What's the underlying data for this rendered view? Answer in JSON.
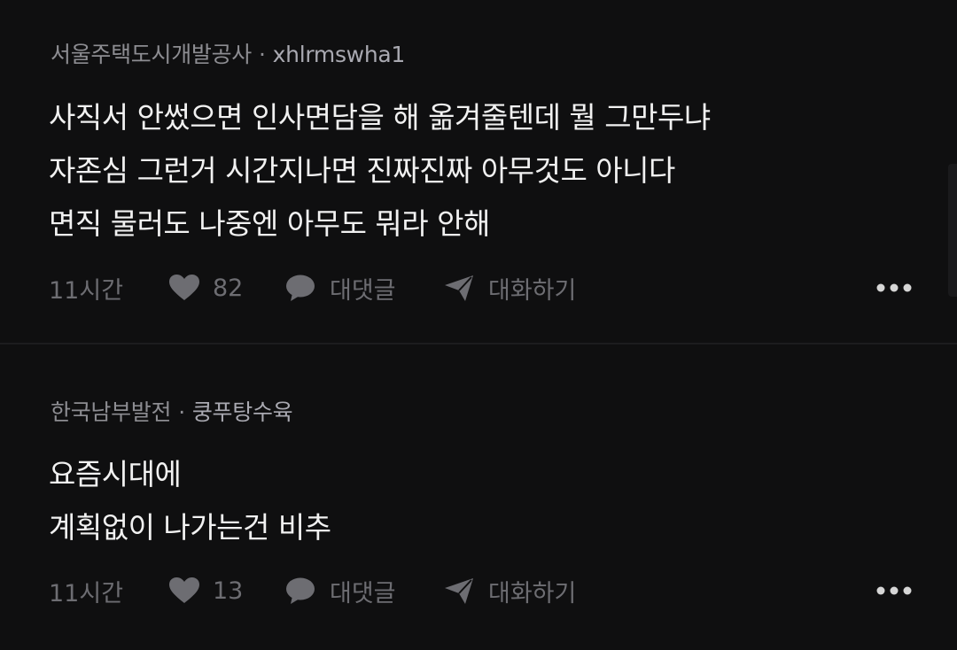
{
  "comments": [
    {
      "company": "서울주택도시개발공사",
      "separator": "·",
      "nickname": "xhlrmswha1",
      "lines": [
        "사직서 안썼으면 인사면담을 해 옮겨줄텐데 뭘 그만두냐",
        "자존심 그런거 시간지나면 진짜진짜 아무것도 아니다",
        "면직 물러도 나중엔 아무도 뭐라 안해"
      ],
      "time": "11시간",
      "likes": "82",
      "reply_label": "대댓글",
      "chat_label": "대화하기"
    },
    {
      "company": "한국남부발전",
      "separator": "·",
      "nickname": "쿵푸탕수육",
      "lines": [
        "요즘시대에",
        "계획없이 나가는건 비추"
      ],
      "time": "11시간",
      "likes": "13",
      "reply_label": "대댓글",
      "chat_label": "대화하기"
    }
  ],
  "icons": {
    "like": "heart-icon",
    "reply": "speech-bubble-icon",
    "chat": "paper-plane-icon",
    "more": "more-dots-icon"
  },
  "colors": {
    "background": "#0f0f10",
    "text": "#f1f1f1",
    "meta": "#8d8d92",
    "muted": "#6d6d72"
  }
}
